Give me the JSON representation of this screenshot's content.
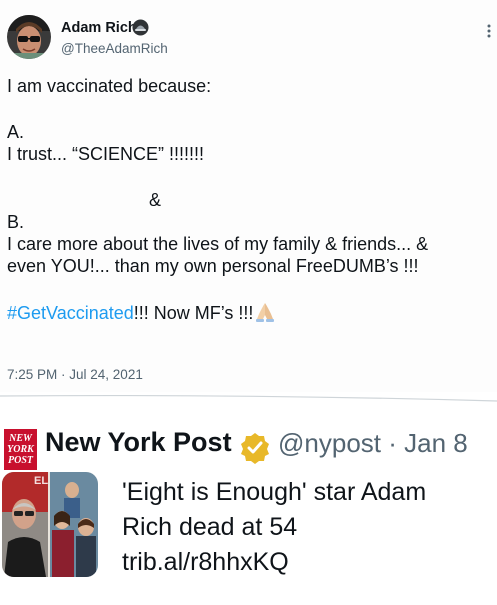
{
  "tweet": {
    "author_name": "Adam Rich",
    "author_handle": "@TheeAdamRich",
    "lines": [
      "I am vaccinated because:",
      "A.",
      "I trust... “SCIENCE” !!!!!!!",
      "&",
      "B.",
      "I care more about the lives of my family & friends... &",
      "even YOU!... than my own personal FreeDUMB’s !!!"
    ],
    "hashtag": "#GetVaccinated",
    "hashtag_tail": "!!! Now MF’s !!!",
    "timestamp": "7:25 PM · Jul 24, 2021"
  },
  "quoted": {
    "logo_text": [
      "NEW",
      "YORK",
      "POST"
    ],
    "author_name": "New York Post",
    "handle_date": "@nypost · Jan 8",
    "lines": [
      "'Eight is Enough' star Adam",
      "Rich dead at 54",
      "trib.al/r8hhxKQ"
    ]
  },
  "colors": {
    "link": "#1d9bf0",
    "secondary_text": "#536471",
    "nyp_red": "#c8102e",
    "verified_gold": "#e8b829"
  },
  "icons": {
    "badge": "hat-icon",
    "more": "more-icon",
    "emoji": "folded-hands-icon",
    "verified": "verified-gold-icon"
  }
}
